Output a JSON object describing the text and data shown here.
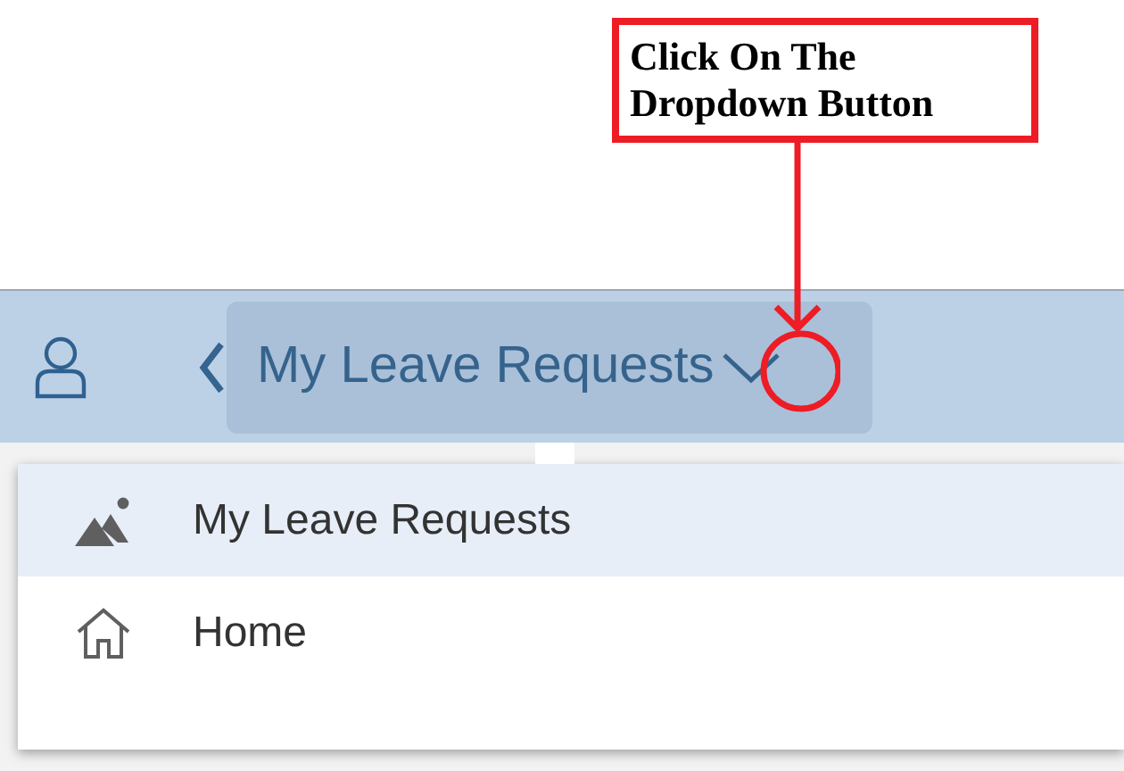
{
  "annotation": {
    "text": "Click On The Dropdown Button"
  },
  "header": {
    "title": "My Leave Requests"
  },
  "menu": {
    "items": [
      {
        "label": "My Leave Requests",
        "kind": "app",
        "selected": true
      },
      {
        "label": "Home",
        "kind": "home",
        "selected": false
      }
    ]
  }
}
